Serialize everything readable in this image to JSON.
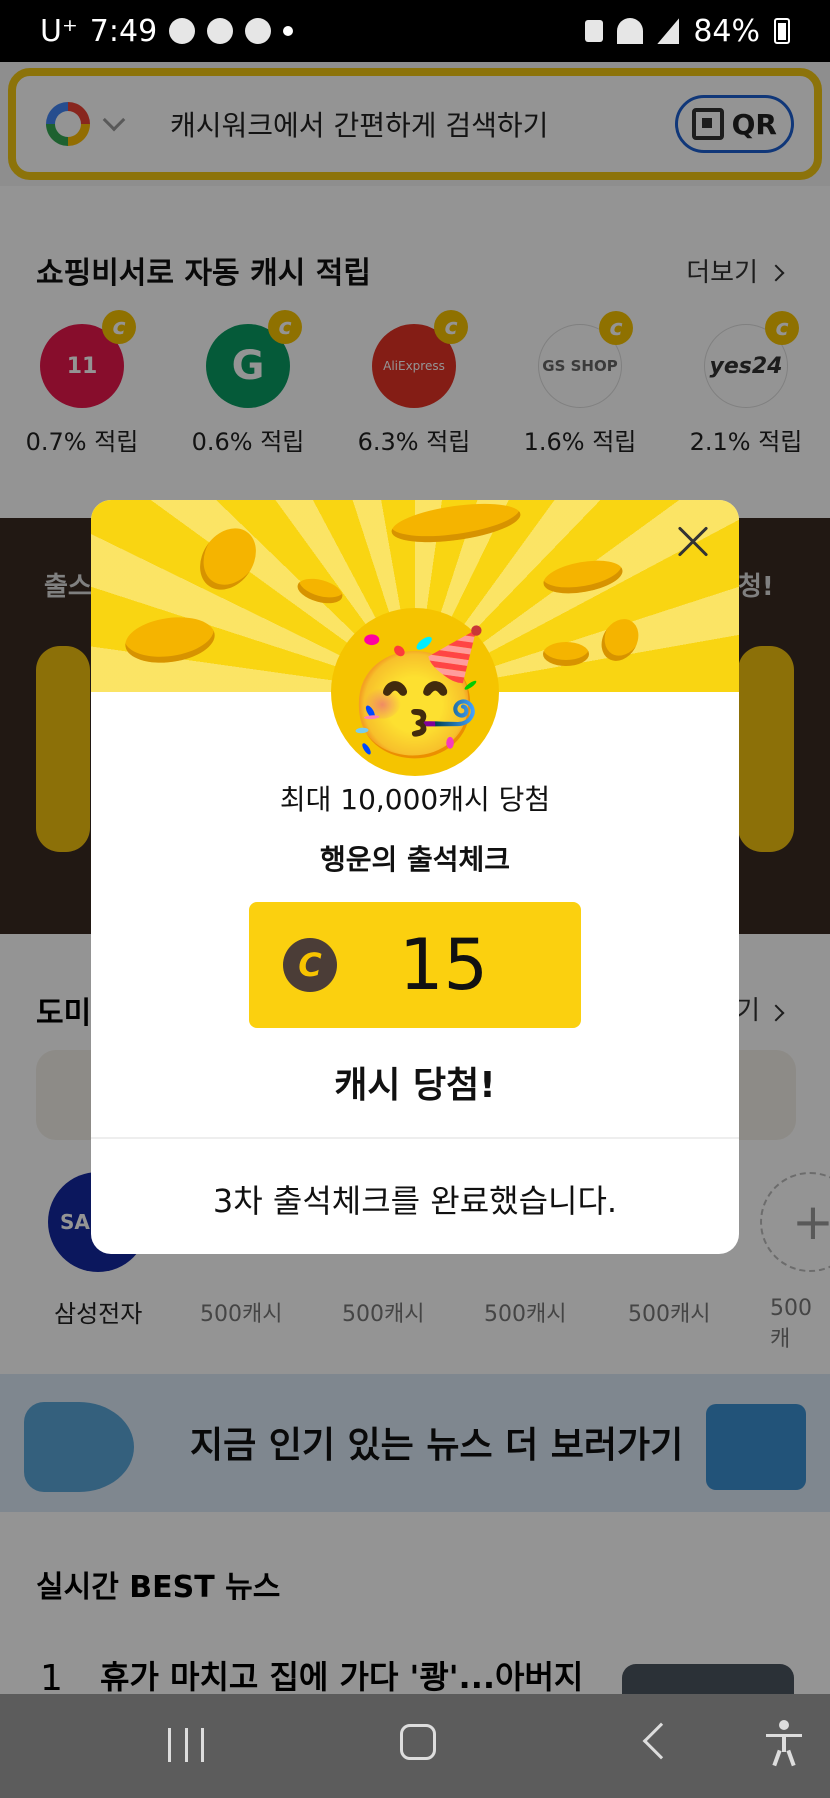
{
  "status": {
    "carrier": "U⁺",
    "time": "7:49",
    "battery": "84%"
  },
  "search": {
    "placeholder": "캐시워크에서 간편하게 검색하기",
    "qr_label": "QR"
  },
  "shopping": {
    "title": "쇼핑비서로 자동 캐시 적립",
    "more_label": "더보기",
    "items": [
      {
        "name": "11번가",
        "label": "0.7% 적립",
        "logo_text": "11",
        "color": "#e8174d"
      },
      {
        "name": "G마켓",
        "label": "0.6% 적립",
        "logo_text": "G",
        "color": "#0a9c62"
      },
      {
        "name": "AliExpress",
        "label": "6.3% 적립",
        "logo_text": "AliExpress",
        "color": "#e43225"
      },
      {
        "name": "GS SHOP",
        "label": "1.6% 적립",
        "logo_text": "GS SHOP",
        "color": "#f2f2f2"
      },
      {
        "name": "yes24",
        "label": "2.1% 적립",
        "logo_text": "yes24",
        "color": "#f2f2f2"
      }
    ]
  },
  "dark_section": {
    "text_left": "출스",
    "text_right": "청!"
  },
  "domi": {
    "title": "도미",
    "more_label": "기",
    "brand_label": "삼성전자",
    "brand_logo": "SAM",
    "cash_labels": [
      "500캐시",
      "500캐시",
      "500캐시",
      "500캐시",
      "500캐"
    ]
  },
  "news_banner": {
    "text": "지금 인기 있는 뉴스 더 보러가기"
  },
  "best": {
    "title": "실시간 BEST 뉴스",
    "rank": "1",
    "headline": "휴가 마치고 집에 가다 '쾅'...아버지"
  },
  "modal": {
    "subtitle": "최대 10,000캐시 당첨",
    "title": "행운의 출석체크",
    "coin_symbol": "C",
    "amount": "15",
    "prize_label": "캐시 당첨!",
    "complete_message": "3차 출석체크를 완료했습니다.",
    "emoji": "🥳"
  },
  "colors": {
    "brand_yellow": "#f9d512",
    "dim": "rgba(0,0,0,0.42)"
  }
}
